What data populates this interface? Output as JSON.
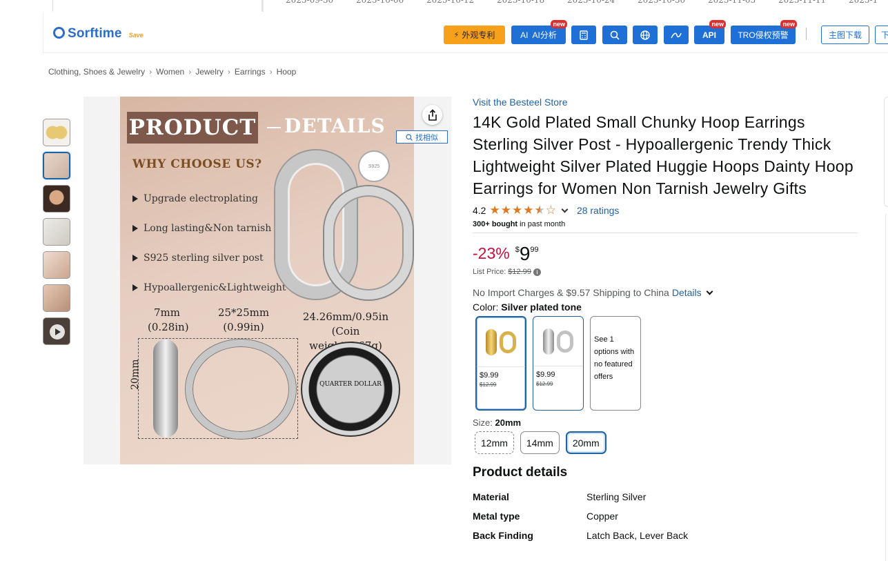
{
  "chart_strip": {
    "dates": [
      "2025-09-30",
      "2025-10-06",
      "2025-10-12",
      "2025-10-18",
      "2025-10-24",
      "2025-10-30",
      "2025-11-05",
      "2025-11-11",
      "2025-1"
    ]
  },
  "toolbar": {
    "logo_text": "Sorftime",
    "logo_sub": "Save",
    "patent_label": "外观专利",
    "ai_label": "AI  AI分析",
    "api_label": "API",
    "tro_label": "TRO侵权预警",
    "main_image_download": "主图下载",
    "more_label": "下",
    "new_badge": "new"
  },
  "breadcrumb": [
    "Clothing, Shoes & Jewelry",
    "Women",
    "Jewelry",
    "Earrings",
    "Hoop"
  ],
  "breadcrumb_sep": "›",
  "main_image": {
    "title_1": "PRODUCT",
    "title_2": "DETAILS",
    "why": "WHY CHOOSE US?",
    "bullets": [
      "Upgrade electroplating",
      "Long lasting&Non tarnish",
      "S925 sterling silver post",
      "Hypoallergenic&Lightweight"
    ],
    "dim_1": "7mm",
    "dim_1b": "(0.28in)",
    "dim_2": "25*25mm",
    "dim_2b": "(0.99in)",
    "dim_3": "24.26mm/0.95in",
    "dim_3b": "(Coin weight:5.67g)",
    "dim_vertical": "20mm",
    "tag": "S925",
    "coin_label": "QUARTER DOLLAR",
    "find_similar": "找相似"
  },
  "product": {
    "store": "Visit the Besteel Store",
    "title": "14K Gold Plated Small Chunky Hoop Earrings Sterling Silver Post - Hypoallergenic Trendy Thick Lightweight Silver Plated Huggie Hoops Dainty Hoop Earrings for Women Non Tarnish Jewelry Gifts",
    "rating": "4.2",
    "rating_value": 4.2,
    "stars": "★★★★",
    "star_half": "★",
    "star_empty": "☆",
    "ratings_count": "28 ratings",
    "bought_bold": "300+ bought",
    "bought_rest": " in past month",
    "discount": "-23%",
    "price_symbol": "$",
    "price_whole": "9",
    "price_fraction": "99",
    "list_price_label": "List Price:",
    "list_price": "$12.99",
    "import_text": "No Import Charges & $9.57 Shipping to China",
    "details_link": "Details",
    "color_label": "Color:",
    "color_value": "Silver plated tone",
    "swatches": [
      {
        "price": "$9.99",
        "list": "$12.99"
      },
      {
        "price": "$9.99",
        "list": "$12.99"
      }
    ],
    "swatch_note": "See 1 options with no featured offers",
    "size_label": "Size:",
    "size_value": "20mm",
    "sizes": [
      "12mm",
      "14mm",
      "20mm"
    ],
    "details_title": "Product details",
    "details": [
      {
        "key": "Material",
        "value": "Sterling Silver"
      },
      {
        "key": "Metal type",
        "value": "Copper"
      },
      {
        "key": "Back Finding",
        "value": "Latch Back, Lever Back"
      }
    ]
  }
}
